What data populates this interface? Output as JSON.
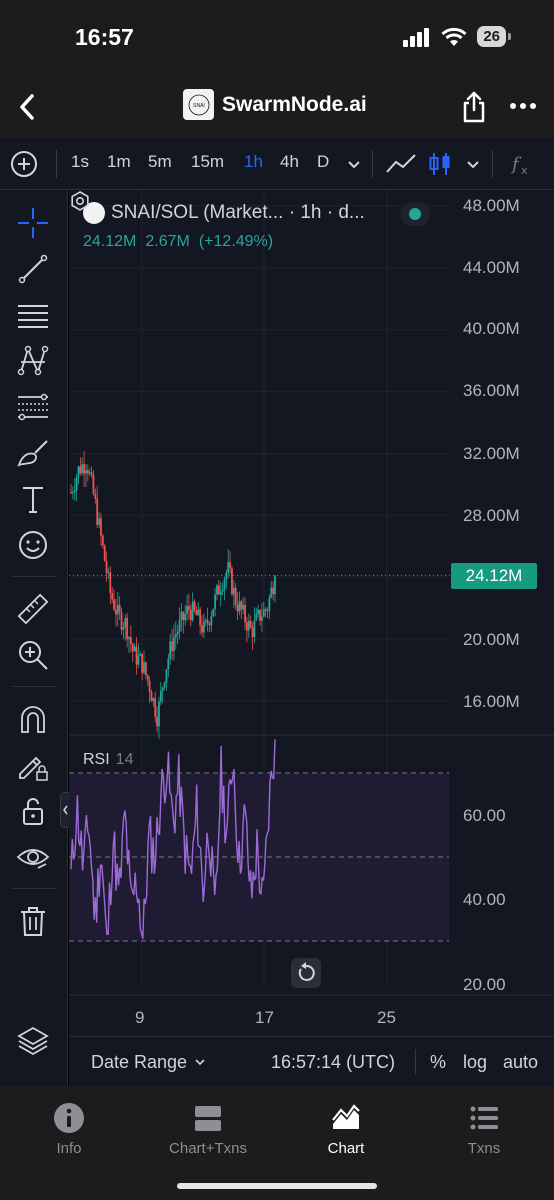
{
  "status_bar": {
    "time": "16:57",
    "battery": "26"
  },
  "nav": {
    "title": "SwarmNode.ai",
    "logo_text": "SNAI"
  },
  "toolbar": {
    "intervals": [
      "1s",
      "1m",
      "5m",
      "15m",
      "1h",
      "4h",
      "D"
    ],
    "active_interval": "1h",
    "function_icon": "fx-icon"
  },
  "legend": {
    "title": "SNAI/SOL (Market... · 1h · d...",
    "value": "24.12M",
    "change": "2.67M",
    "change_pct": "(+12.49%)"
  },
  "price_axis": {
    "labels": [
      "48.00M",
      "44.00M",
      "40.00M",
      "36.00M",
      "32.00M",
      "28.00M",
      "20.00M",
      "16.00M"
    ],
    "last_price": "24.12M"
  },
  "rsi": {
    "title": "RSI",
    "period": "14",
    "labels": [
      "60.00",
      "40.00",
      "20.00"
    ]
  },
  "time_axis": {
    "labels": [
      "9",
      "17",
      "25"
    ]
  },
  "bottom_bar": {
    "date_range": "Date Range",
    "clock": "16:57:14 (UTC)",
    "percent": "%",
    "log": "log",
    "auto": "auto"
  },
  "tabs": [
    {
      "label": "Info",
      "icon": "info-icon"
    },
    {
      "label": "Chart+Txns",
      "icon": "split-panel-icon"
    },
    {
      "label": "Chart",
      "icon": "mountain-chart-icon",
      "active": true
    },
    {
      "label": "Txns",
      "icon": "list-icon"
    }
  ],
  "colors": {
    "up": "#26a69a",
    "down": "#ef5350",
    "rsi": "#9b6cd6",
    "accent": "#2962ff",
    "last_price_bg": "#169b7f"
  },
  "chart_data": {
    "type": "candlestick",
    "price_unit": "M",
    "y_range": [
      14,
      48
    ],
    "x_ticks": [
      "9",
      "17",
      "25"
    ],
    "approx_price_path": [
      29.5,
      31,
      31.5,
      29,
      26,
      23,
      21.5,
      21,
      19,
      18.5,
      17,
      15,
      18,
      20,
      21,
      22,
      21.5,
      20.5,
      22,
      23.5,
      24.5,
      22.5,
      21.5,
      20.5,
      21.5,
      22,
      24.12
    ],
    "last_price": 24.12,
    "rsi": {
      "period": 14,
      "y_range": [
        20,
        80
      ],
      "levels": [
        70,
        50,
        30
      ],
      "approx_values": [
        45,
        62,
        48,
        58,
        35,
        52,
        28,
        55,
        40,
        60,
        38,
        45,
        30,
        55,
        50,
        65,
        72,
        58,
        68,
        52,
        45,
        62,
        42,
        58,
        35,
        70,
        55,
        75,
        48,
        60,
        40,
        52,
        38,
        62,
        78
      ]
    }
  }
}
